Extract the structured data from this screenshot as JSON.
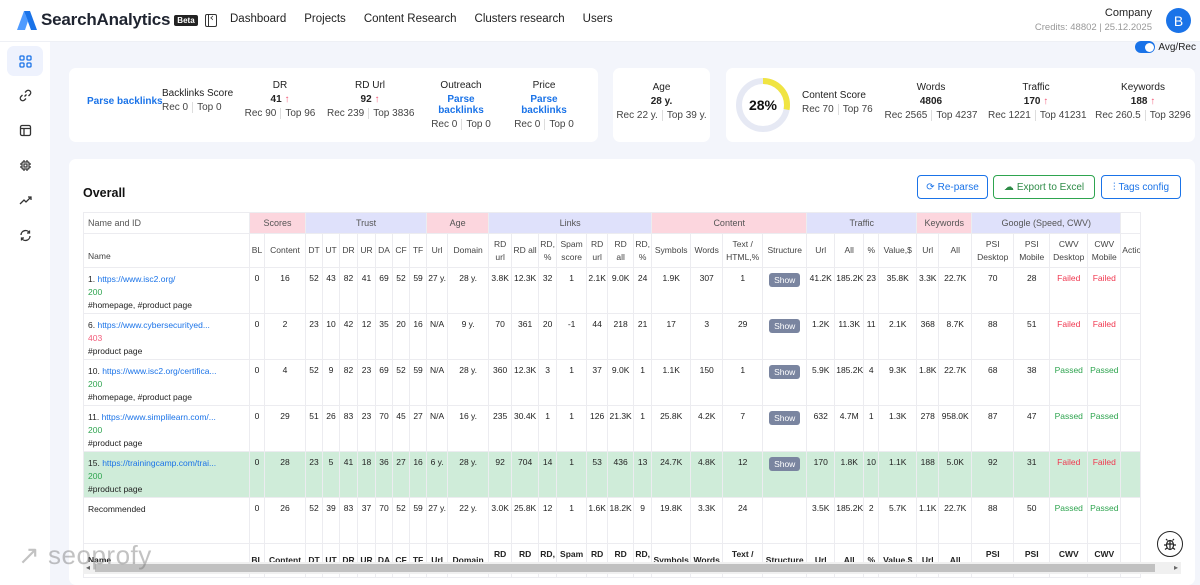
{
  "app": {
    "name": "SearchAnalytics",
    "badge": "Beta",
    "nav": [
      "Dashboard",
      "Projects",
      "Content Research",
      "Clusters research",
      "Users"
    ],
    "account": {
      "company": "Company",
      "credits": "Credits: 48802 | 25.12.2025",
      "avatar_letter": "B"
    },
    "toggle_label": "Avg/Rec",
    "sidebar_icons": [
      "grid-icon",
      "link-icon",
      "layout-icon",
      "chip-icon",
      "trending-up-icon",
      "refresh-icon"
    ],
    "watermark": "seoprofy"
  },
  "summary": {
    "parse_backlinks": "Parse backlinks",
    "backlinks_score": {
      "title": "Backlinks Score",
      "rec": "Rec 0",
      "top": "Top 0"
    },
    "dr": {
      "title": "DR",
      "value": "41",
      "trend": "↑",
      "rec": "Rec 90",
      "top": "Top 96"
    },
    "rd_url": {
      "title": "RD Url",
      "value": "92",
      "trend": "↑",
      "rec": "Rec 239",
      "top": "Top 3836"
    },
    "outreach": {
      "title": "Outreach",
      "value": "Parse backlinks",
      "rec": "Rec 0",
      "top": "Top 0"
    },
    "price": {
      "title": "Price",
      "value": "Parse backlinks",
      "rec": "Rec 0",
      "top": "Top 0"
    },
    "age": {
      "title": "Age",
      "value": "28 y.",
      "rec": "Rec 22 y.",
      "top": "Top 39 y."
    },
    "content_score": {
      "percent_label": "28%",
      "percent": 28,
      "title": "Content Score",
      "rec": "Rec 70",
      "top": "Top 76",
      "color": "#f0e442"
    },
    "words": {
      "title": "Words",
      "value": "4806",
      "rec": "Rec 2565",
      "top": "Top 4237"
    },
    "traffic": {
      "title": "Traffic",
      "value": "170",
      "trend": "↑",
      "rec": "Rec 1221",
      "top": "Top 41231"
    },
    "keywords": {
      "title": "Keywords",
      "value": "188",
      "trend": "↑",
      "rec": "Rec 260.5",
      "top": "Top 3296"
    }
  },
  "table": {
    "title": "Overall",
    "buttons": {
      "reparse": "Re-parse",
      "export": "Export to Excel",
      "tags": "Tags config"
    },
    "groups": [
      {
        "label": "Name and ID",
        "span": 1,
        "style": "plain"
      },
      {
        "label": "Scores",
        "span": 2,
        "style": "pink"
      },
      {
        "label": "Trust",
        "span": 7,
        "style": "lav"
      },
      {
        "label": "Age",
        "span": 2,
        "style": "pink"
      },
      {
        "label": "Links",
        "span": 7,
        "style": "lav"
      },
      {
        "label": "Content",
        "span": 4,
        "style": "pink"
      },
      {
        "label": "Traffic",
        "span": 4,
        "style": "lav"
      },
      {
        "label": "Keywords",
        "span": 2,
        "style": "pink"
      },
      {
        "label": "Google (Speed, CWV)",
        "span": 4,
        "style": "lav"
      },
      {
        "label": "",
        "span": 1,
        "style": "plain"
      }
    ],
    "columns": [
      "Name",
      "BL",
      "Content",
      "DT",
      "UT",
      "DR",
      "UR",
      "DA",
      "CF",
      "TF",
      "Url",
      "Domain",
      "RD url",
      "RD all",
      "RD, %",
      "Spam score",
      "RD url",
      "RD all",
      "RD, %",
      "Symbols",
      "Words",
      "Text / HTML,%",
      "Structure",
      "Url",
      "All",
      "%",
      "Value,$",
      "Url",
      "All",
      "PSI Desktop",
      "PSI Mobile",
      "CWV Desktop",
      "CWV Mobile",
      "Actions"
    ],
    "footer_columns": [
      "Name",
      "BL",
      "Content",
      "DT",
      "UT",
      "DR",
      "UR",
      "DA",
      "CF",
      "TF",
      "Url",
      "Domain",
      "RD url",
      "RD all",
      "RD, %",
      "Spam score",
      "RD url",
      "RD all",
      "RD, %",
      "Symbols",
      "Words",
      "Text / HTML,%",
      "Structure",
      "Url",
      "All",
      "%",
      "Value,$",
      "Url",
      "All",
      "PSI Desktop",
      "PSI Mobile",
      "CWV Desktop",
      "CWV Mobile",
      ""
    ],
    "rows": [
      {
        "id": "1.",
        "url": "https://www.isc2.org/",
        "status": "200",
        "status_ok": true,
        "tags": "#homepage, #product page",
        "highlight": false,
        "cells": [
          "0",
          "16",
          "52",
          "43",
          "82",
          "41",
          "69",
          "52",
          "59",
          "27 y.",
          "28 y.",
          "3.8K",
          "12.3K",
          "32",
          "1",
          "2.1K",
          "9.0K",
          "24",
          "1.9K",
          "307",
          "1",
          "Show",
          "41.2K",
          "185.2K",
          "23",
          "35.8K",
          "3.3K",
          "22.7K",
          "70",
          "28",
          "Failed",
          "Failed",
          ""
        ]
      },
      {
        "id": "6.",
        "url": "https://www.cybersecurityed...",
        "status": "403",
        "status_ok": false,
        "tags": "#product page",
        "highlight": false,
        "cells": [
          "0",
          "2",
          "23",
          "10",
          "42",
          "12",
          "35",
          "20",
          "16",
          "N/A",
          "9 y.",
          "70",
          "361",
          "20",
          "-1",
          "44",
          "218",
          "21",
          "17",
          "3",
          "29",
          "Show",
          "1.2K",
          "11.3K",
          "11",
          "2.1K",
          "368",
          "8.7K",
          "88",
          "51",
          "Failed",
          "Failed",
          ""
        ]
      },
      {
        "id": "10.",
        "url": "https://www.isc2.org/certifica...",
        "status": "200",
        "status_ok": true,
        "tags": "#homepage, #product page",
        "highlight": false,
        "cells": [
          "0",
          "4",
          "52",
          "9",
          "82",
          "23",
          "69",
          "52",
          "59",
          "N/A",
          "28 y.",
          "360",
          "12.3K",
          "3",
          "1",
          "37",
          "9.0K",
          "1",
          "1.1K",
          "150",
          "1",
          "Show",
          "5.9K",
          "185.2K",
          "4",
          "9.3K",
          "1.8K",
          "22.7K",
          "68",
          "38",
          "Passed",
          "Passed",
          ""
        ]
      },
      {
        "id": "11.",
        "url": "https://www.simplilearn.com/...",
        "status": "200",
        "status_ok": true,
        "tags": "#product page",
        "highlight": false,
        "cells": [
          "0",
          "29",
          "51",
          "26",
          "83",
          "23",
          "70",
          "45",
          "27",
          "N/A",
          "16 y.",
          "235",
          "30.4K",
          "1",
          "1",
          "126",
          "21.3K",
          "1",
          "25.8K",
          "4.2K",
          "7",
          "Show",
          "632",
          "4.7M",
          "1",
          "1.3K",
          "278",
          "958.0K",
          "87",
          "47",
          "Passed",
          "Passed",
          ""
        ]
      },
      {
        "id": "15.",
        "url": "https://trainingcamp.com/trai...",
        "status": "200",
        "status_ok": true,
        "tags": "#product page",
        "highlight": true,
        "cells": [
          "0",
          "28",
          "23",
          "5",
          "41",
          "18",
          "36",
          "27",
          "16",
          "6 y.",
          "28 y.",
          "92",
          "704",
          "14",
          "1",
          "53",
          "436",
          "13",
          "24.7K",
          "4.8K",
          "12",
          "Show",
          "170",
          "1.8K",
          "10",
          "1.1K",
          "188",
          "5.0K",
          "92",
          "31",
          "Failed",
          "Failed",
          ""
        ]
      }
    ],
    "recommended": {
      "label": "Recommended",
      "cells": [
        "0",
        "26",
        "52",
        "39",
        "83",
        "37",
        "70",
        "52",
        "59",
        "27 y.",
        "22 y.",
        "3.0K",
        "25.8K",
        "12",
        "1",
        "1.6K",
        "18.2K",
        "9",
        "19.8K",
        "3.3K",
        "24",
        "",
        "3.5K",
        "185.2K",
        "2",
        "5.7K",
        "1.1K",
        "22.7K",
        "88",
        "50",
        "Passed",
        "Passed",
        ""
      ]
    }
  }
}
